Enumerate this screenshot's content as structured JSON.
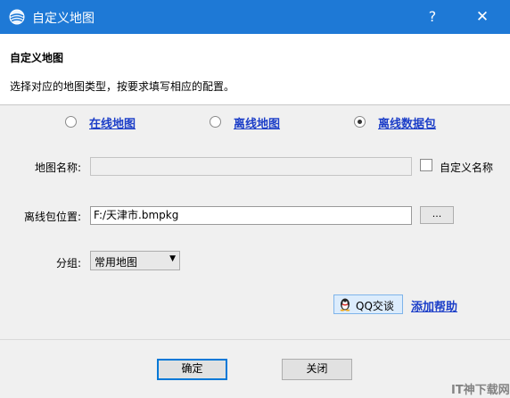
{
  "window": {
    "title": "自定义地图",
    "help_label": "?",
    "close_label": "✕"
  },
  "header": {
    "title": "自定义地图",
    "description": "选择对应的地图类型，按要求填写相应的配置。"
  },
  "map_types": [
    {
      "label": "在线地图",
      "selected": false
    },
    {
      "label": "离线地图",
      "selected": false
    },
    {
      "label": "离线数据包",
      "selected": true
    }
  ],
  "form": {
    "name_label": "地图名称:",
    "name_value": "",
    "custom_name_label": "自定义名称",
    "path_label": "离线包位置:",
    "path_value": "F:/天津市.bmpkg",
    "browse_label": "...",
    "group_label": "分组:",
    "group_value": "常用地图"
  },
  "actions": {
    "qq_label": "QQ交谈",
    "help_link": "添加帮助"
  },
  "footer": {
    "ok_label": "确定",
    "close_label": "关闭"
  },
  "watermark": "IT神下载网",
  "colors": {
    "titlebar": "#1e79d6",
    "link": "#1c3ec8",
    "panel": "#f0f0f0"
  }
}
